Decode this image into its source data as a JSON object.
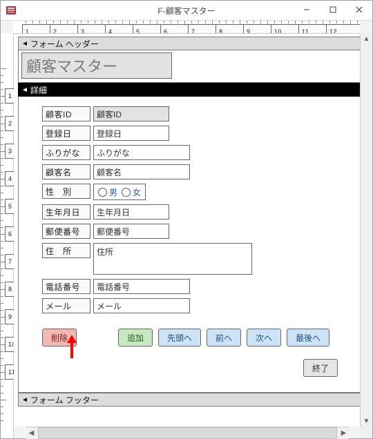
{
  "window": {
    "title": "F-顧客マスター"
  },
  "sections": {
    "header_bar": "フォーム ヘッダー",
    "detail_bar": "詳細",
    "footer_bar": "フォーム フッター"
  },
  "form_header": {
    "title": "顧客マスター"
  },
  "fields": {
    "customer_id": {
      "label": "顧客ID",
      "value": "顧客ID"
    },
    "reg_date": {
      "label": "登録日",
      "value": "登録日"
    },
    "furigana": {
      "label": "ふりがな",
      "value": "ふりがな"
    },
    "customer_name": {
      "label": "顧客名",
      "value": "顧客名"
    },
    "gender": {
      "label": "性　別",
      "options": [
        "男",
        "女"
      ]
    },
    "birthday": {
      "label": "生年月日",
      "value": "生年月日"
    },
    "postal": {
      "label": "郵便番号",
      "value": "郵便番号"
    },
    "address": {
      "label": "住　所",
      "value": "住所"
    },
    "phone": {
      "label": "電話番号",
      "value": "電話番号"
    },
    "mail": {
      "label": "メール",
      "value": "メール"
    }
  },
  "buttons": {
    "delete": "削除",
    "add": "追加",
    "first": "先頭へ",
    "prev": "前へ",
    "next": "次へ",
    "last": "最後へ",
    "close": "終了"
  },
  "ruler_h": [
    1,
    2,
    3,
    4,
    5,
    6,
    7,
    8,
    9,
    10,
    11,
    12
  ],
  "ruler_v": [
    1,
    2,
    3,
    4,
    5,
    6,
    7,
    8,
    9,
    10,
    11
  ]
}
